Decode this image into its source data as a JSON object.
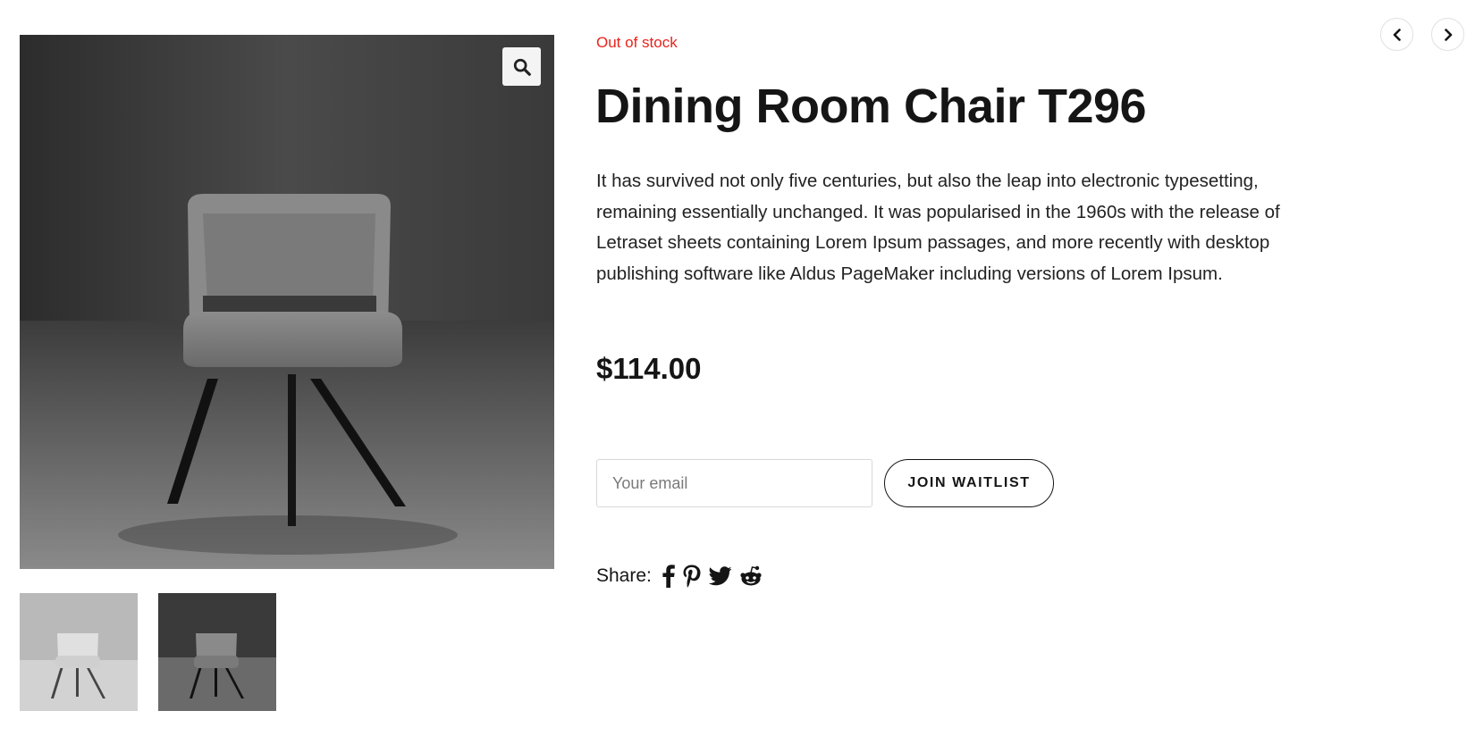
{
  "product": {
    "stock_status": "Out of stock",
    "title": "Dining Room Chair T296",
    "description": "It has survived not only five centuries, but also the leap into electronic typesetting, remaining essentially unchanged. It was popularised in the 1960s with the release of Letraset sheets containing Lorem Ipsum passages, and more recently with desktop publishing software like Aldus PageMaker including versions of Lorem Ipsum.",
    "price": "$114.00"
  },
  "waitlist": {
    "email_placeholder": "Your email",
    "email_value": "",
    "button_label": "JOIN WAITLIST"
  },
  "share": {
    "label": "Share:",
    "icons": [
      "facebook-icon",
      "pinterest-icon",
      "twitter-icon",
      "reddit-icon"
    ]
  },
  "gallery": {
    "zoom_icon": "search-icon",
    "thumbnails": [
      "chair-light",
      "chair-dark"
    ]
  },
  "navigation": {
    "prev_icon": "chevron-left-icon",
    "next_icon": "chevron-right-icon"
  },
  "colors": {
    "stock_status": "#e8231b",
    "text": "#151515"
  }
}
